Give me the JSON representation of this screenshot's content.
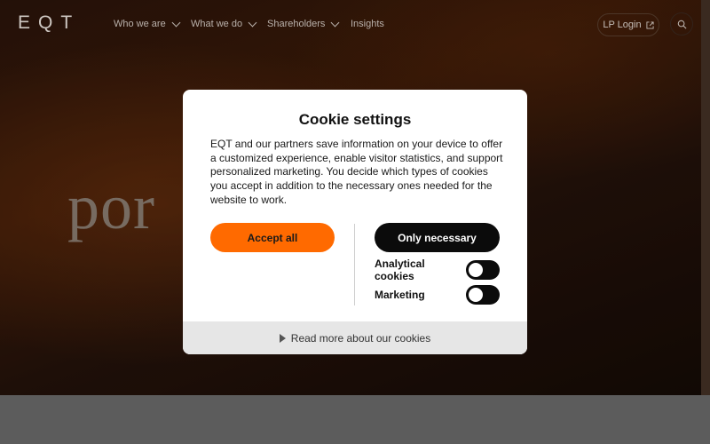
{
  "brand": {
    "logo_letters": [
      "E",
      "Q",
      "T"
    ]
  },
  "nav": {
    "items": [
      {
        "label": "Who we are",
        "has_dropdown": true
      },
      {
        "label": "What we do",
        "has_dropdown": true
      },
      {
        "label": "Shareholders",
        "has_dropdown": true
      },
      {
        "label": "Insights",
        "has_dropdown": false
      }
    ],
    "lp_login_label": "LP Login",
    "lp_login_icon": "external-link-icon",
    "search_icon": "search-icon"
  },
  "hero": {
    "partial_word": "por"
  },
  "cookie_modal": {
    "title": "Cookie settings",
    "description": "EQT and our partners save information on your device to offer a customized experience, enable visitor statistics, and support personalized marketing. You decide which types of cookies you accept in addition to the necessary ones needed for the website to work.",
    "accept_all_label": "Accept all",
    "only_necessary_label": "Only necessary",
    "toggles": [
      {
        "label": "Analytical cookies",
        "on": false
      },
      {
        "label": "Marketing",
        "on": false
      }
    ],
    "read_more_label": "Read more about our cookies"
  },
  "colors": {
    "accent": "#ff6a00",
    "dark_button": "#0b0b0b"
  }
}
